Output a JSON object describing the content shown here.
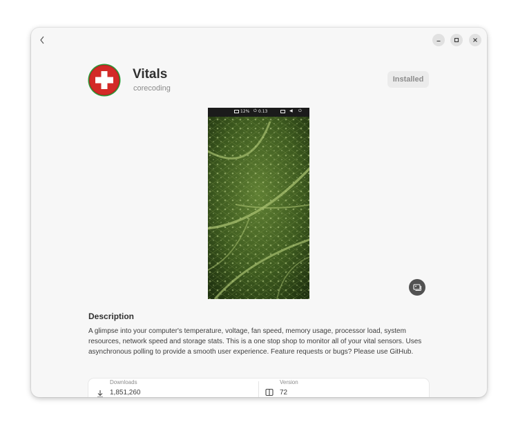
{
  "app": {
    "name": "Vitals",
    "developer": "corecoding",
    "install_status": "Installed",
    "icon": "swiss-cross-icon"
  },
  "screenshot": {
    "topbar": {
      "cpu": "12%",
      "load": "0.13"
    }
  },
  "description": {
    "title": "Description",
    "text": "A glimpse into your computer's temperature, voltage, fan speed, memory usage, processor load, system resources, network speed and storage stats. This is a one stop shop to monitor all of your vital sensors. Uses asynchronous polling to provide a smooth user experience. Feature requests or bugs? Please use GitHub."
  },
  "details": {
    "downloads_label": "Downloads",
    "downloads_value": "1,851,260",
    "version_label": "Version",
    "version_value": "72"
  },
  "colors": {
    "accent_red": "#d32a27",
    "accent_green": "#2f9a3a",
    "leaf": "#2f4a18"
  }
}
